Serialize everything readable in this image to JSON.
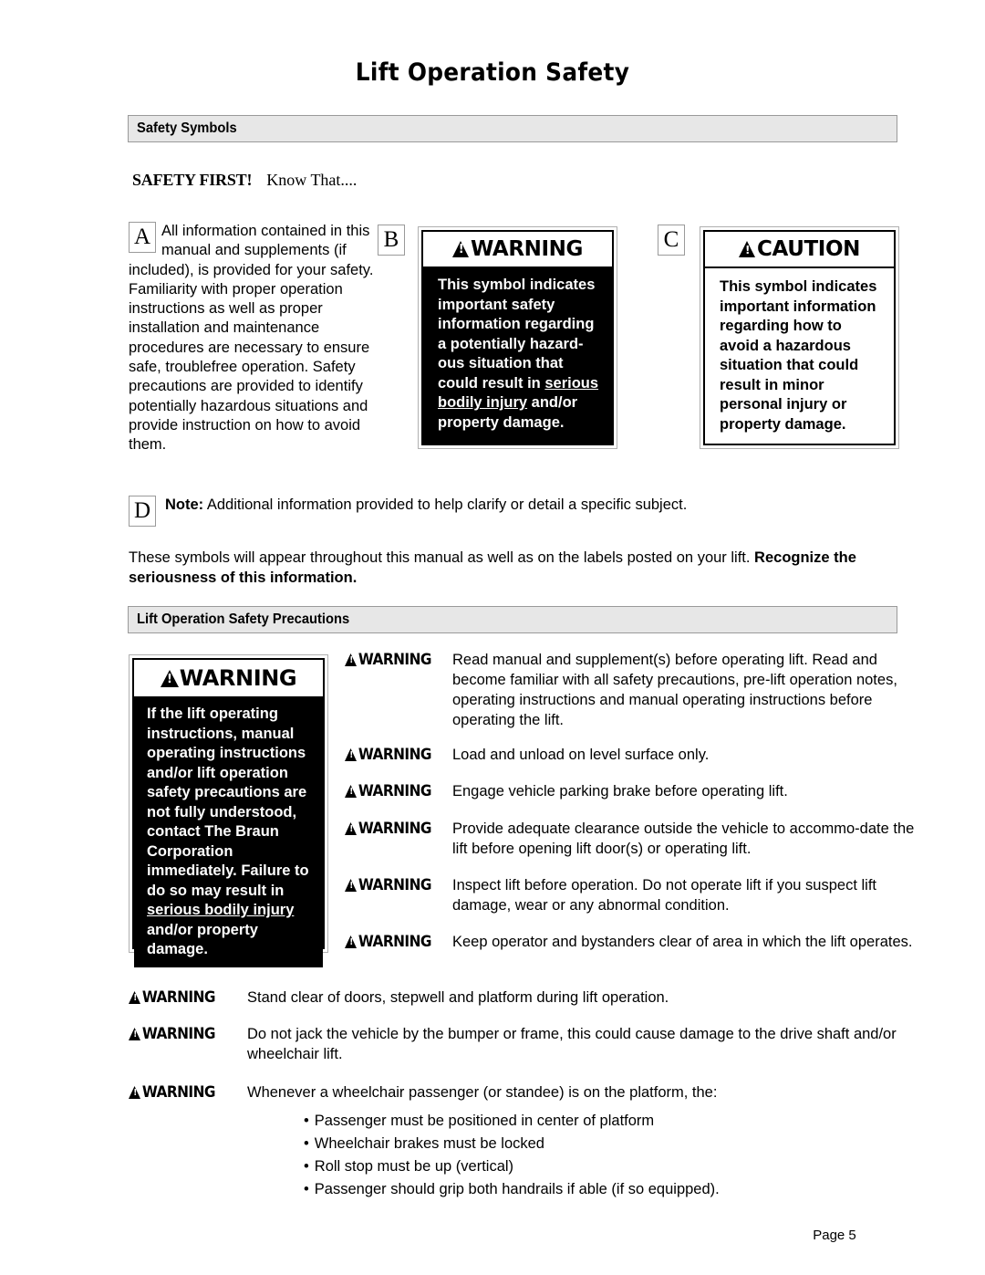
{
  "document": {
    "title": "Lift Operation Safety",
    "footer": "Page 5"
  },
  "sections": {
    "safety_symbols": {
      "heading": "Safety Symbols",
      "intro_bold": "SAFETY FIRST!",
      "intro_rest": "Know That...."
    },
    "precautions": {
      "heading": "Lift Operation Safety Precautions"
    }
  },
  "symbol_items": {
    "a": {
      "badge": "A",
      "text": "All information contained in this manual and supplements (if included), is provided for your safety.  Familiarity with proper operation instructions as well as proper installation and maintenance procedures are necessary to ensure safe, troublefree operation.  Safety precautions are provided to identify potentially hazardous situations and provide instruction on how to avoid them."
    },
    "b": {
      "badge": "B",
      "header": "WARNING",
      "icon": "warning-triangle-icon",
      "style": "white-on-black",
      "body_part1": "This symbol indicates important safety information regarding a potentially hazard-ous situation that could result  in ",
      "body_underline1": "serious bodily injury",
      "body_part2": " and/or property damage."
    },
    "c": {
      "badge": "C",
      "header": "CAUTION",
      "icon": "warning-triangle-icon",
      "style": "black-on-white",
      "body": "This symbol indicates important  information regarding how to avoid a hazardous situation that could result in minor personal injury or property damage."
    },
    "d": {
      "badge": "D",
      "keyword": "Note:",
      "text": "Additional information provided to help clarify or detail a specific subject."
    }
  },
  "symbols_paragraph": {
    "normal": "These symbols will appear throughout this manual as well as on the labels posted on your lift.  ",
    "bold": "Recognize the seriousness of this information."
  },
  "big_warning": {
    "header": "WARNING",
    "icon": "warning-triangle-icon",
    "body_part1": "If the lift operating instructions, manual operating instructions and/or lift operation safety precautions are not fully understood, contact The Braun Corporation immediately.  Failure to do so may result in ",
    "body_underline1": "serious bodily injury",
    "body_part2": " and/or property damage."
  },
  "warnings": {
    "tag": "WARNING",
    "icon": "warning-triangle-icon",
    "right_column": [
      "Read manual and supplement(s) before operating lift.  Read and become familiar with all safety precautions, pre-lift operation notes, operating instructions and manual operating instructions before operating the lift.",
      "Load and unload on level surface only.",
      "Engage vehicle parking brake before operating lift.",
      "Provide adequate clearance outside the vehicle to accommo-date the lift before opening lift door(s) or operating lift.",
      "Inspect lift before operation.  Do not operate lift if you suspect lift damage, wear or any abnormal condition.",
      "Keep operator and bystanders clear of area in which the lift operates."
    ],
    "full_width": [
      "Stand clear of doors, stepwell and platform during lift operation.",
      "Do not jack the vehicle by the bumper or frame, this could cause damage to the drive shaft and/or wheelchair lift.",
      "Whenever a wheelchair passenger (or standee) is on the platform, the:"
    ],
    "bullets": [
      "Passenger must be positioned in center of platform",
      "Wheelchair brakes must be locked",
      "Roll stop must be up (vertical)",
      "Passenger should grip both handrails if able (if so equipped)."
    ],
    "bullet_char": "•"
  },
  "colors": {
    "section_bar_bg": "#e7e7e7",
    "section_bar_border": "#9a9a9a",
    "warning_dark_bg": "#000000",
    "warning_text_light": "#ffffff",
    "page_bg": "#ffffff"
  }
}
